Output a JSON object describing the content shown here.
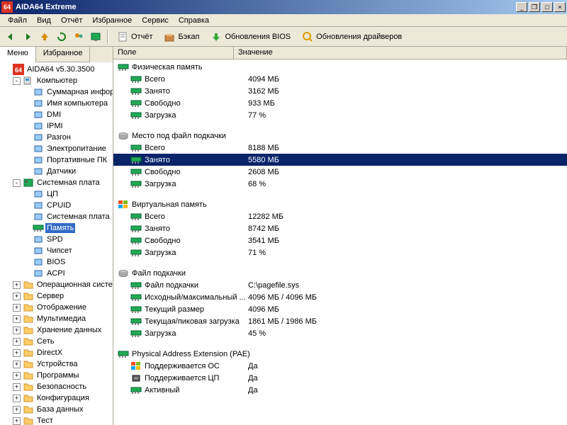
{
  "title": "AIDA64 Extreme",
  "menu": [
    "Файл",
    "Вид",
    "Отчёт",
    "Избранное",
    "Сервис",
    "Справка"
  ],
  "toolbar": {
    "report": "Отчёт",
    "backup": "Бэкап",
    "bios_update": "Обновления BIOS",
    "driver_update": "Обновления драйверов"
  },
  "tabs": {
    "menu": "Меню",
    "favorites": "Избранное"
  },
  "tree": {
    "root": "AIDA64 v5.30.3500",
    "computer": "Компьютер",
    "computer_items": [
      "Суммарная информа...",
      "Имя компьютера",
      "DMI",
      "IPMI",
      "Разгон",
      "Электропитание",
      "Портативные ПК",
      "Датчики"
    ],
    "motherboard": "Системная плата",
    "motherboard_items": [
      "ЦП",
      "CPUID",
      "Системная плата",
      "Память",
      "SPD",
      "Чипсет",
      "BIOS",
      "ACPI"
    ],
    "rest": [
      "Операционная система",
      "Сервер",
      "Отображение",
      "Мультимедиа",
      "Хранение данных",
      "Сеть",
      "DirectX",
      "Устройства",
      "Программы",
      "Безопасность",
      "Конфигурация",
      "База данных",
      "Тест"
    ],
    "selected": "Память"
  },
  "columns": {
    "field": "Поле",
    "value": "Значение"
  },
  "sections": [
    {
      "title": "Физическая память",
      "icon": "ram",
      "rows": [
        {
          "field": "Всего",
          "value": "4094 МБ"
        },
        {
          "field": "Занято",
          "value": "3162 МБ"
        },
        {
          "field": "Свободно",
          "value": "933 МБ"
        },
        {
          "field": "Загрузка",
          "value": "77 %"
        }
      ]
    },
    {
      "title": "Место под файл подкачки",
      "icon": "disk",
      "rows": [
        {
          "field": "Всего",
          "value": "8188 МБ"
        },
        {
          "field": "Занято",
          "value": "5580 МБ",
          "selected": true
        },
        {
          "field": "Свободно",
          "value": "2608 МБ"
        },
        {
          "field": "Загрузка",
          "value": "68 %"
        }
      ]
    },
    {
      "title": "Виртуальная память",
      "icon": "win",
      "rows": [
        {
          "field": "Всего",
          "value": "12282 МБ"
        },
        {
          "field": "Занято",
          "value": "8742 МБ"
        },
        {
          "field": "Свободно",
          "value": "3541 МБ"
        },
        {
          "field": "Загрузка",
          "value": "71 %"
        }
      ]
    },
    {
      "title": "Файл подкачки",
      "icon": "disk",
      "rows": [
        {
          "field": "Файл подкачки",
          "value": "C:\\pagefile.sys"
        },
        {
          "field": "Исходный/максимальный ...",
          "value": "4096 МБ / 4096 МБ"
        },
        {
          "field": "Текущий размер",
          "value": "4096 МБ"
        },
        {
          "field": "Текущая/пиковая загрузка",
          "value": "1861 МБ / 1986 МБ"
        },
        {
          "field": "Загрузка",
          "value": "45 %"
        }
      ]
    },
    {
      "title": "Physical Address Extension (PAE)",
      "icon": "ram",
      "rows": [
        {
          "field": "Поддерживается ОС",
          "value": "Да",
          "icon": "win"
        },
        {
          "field": "Поддерживается ЦП",
          "value": "Да",
          "icon": "cpu"
        },
        {
          "field": "Активный",
          "value": "Да"
        }
      ]
    }
  ]
}
